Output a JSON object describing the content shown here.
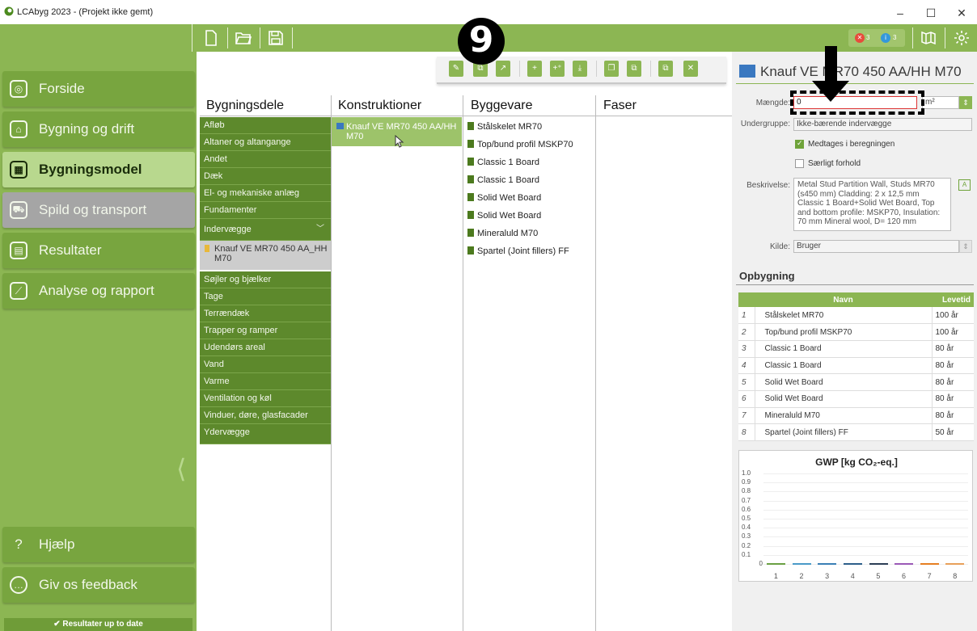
{
  "window": {
    "title": "LCAbyg 2023 - (Projekt ikke gemt)",
    "minimize": "–",
    "maximize": "☐",
    "close": "✕"
  },
  "badges": {
    "errors": "3",
    "infos": "3"
  },
  "step_number": "9",
  "nav": [
    {
      "label": "Forside"
    },
    {
      "label": "Bygning og drift"
    },
    {
      "label": "Bygningsmodel"
    },
    {
      "label": "Spild og transport"
    },
    {
      "label": "Resultater"
    },
    {
      "label": "Analyse og rapport"
    }
  ],
  "nav_bottom": [
    {
      "label": "Hjælp"
    },
    {
      "label": "Giv os feedback"
    }
  ],
  "status": "✔ Resultater up to date",
  "columns": {
    "bygningsdele": "Bygningsdele",
    "konstruktioner": "Konstruktioner",
    "byggevare": "Byggevare",
    "faser": "Faser"
  },
  "categories": [
    "Afløb",
    "Altaner og altangange",
    "Andet",
    "Dæk",
    "El- og mekaniske anlæg",
    "Fundamenter",
    "Indervægge"
  ],
  "selected_category_item": "Knauf VE MR70 450 AA_HH M70",
  "categories_after": [
    "Søjler og bjælker",
    "Tage",
    "Terrændæk",
    "Trapper og ramper",
    "Udendørs areal",
    "Vand",
    "Varme",
    "Ventilation og køl",
    "Vinduer, døre, glasfacader",
    "Ydervægge"
  ],
  "konstruktion": "Knauf VE MR70 450 AA/HH M70",
  "byggevarer": [
    "Stålskelet MR70",
    "Top/bund profil MSKP70",
    "Classic 1 Board",
    "Classic 1 Board",
    "Solid Wet Board",
    "Solid Wet Board",
    "Mineraluld M70",
    "Spartel (Joint fillers) FF"
  ],
  "detail": {
    "title": "Knauf VE MR70 450 AA/HH M70",
    "maengde_label": "Mængde:",
    "maengde_value": "0",
    "unit": "m²",
    "undergruppe_label": "Undergruppe:",
    "undergruppe_value": "Ikke-bærende indervægge",
    "medtages_label": "Medtages i beregningen",
    "saerligt_label": "Særligt forhold",
    "beskrivelse_label": "Beskrivelse:",
    "beskrivelse_value": "Metal Stud Partition Wall, Studs MR70 (s450 mm) Cladding: 2 x 12,5 mm Classic 1 Board+Solid Wet Board, Top and bottom profile: MSKP70, Insulation: 70 mm Mineral wool, D= 120 mm",
    "kilde_label": "Kilde:",
    "kilde_value": "Bruger"
  },
  "opbygning": {
    "title": "Opbygning",
    "headers": {
      "num": "",
      "navn": "Navn",
      "levetid": "Levetid"
    },
    "rows": [
      {
        "n": "1",
        "navn": "Stålskelet MR70",
        "levetid": "100 år"
      },
      {
        "n": "2",
        "navn": "Top/bund profil MSKP70",
        "levetid": "100 år"
      },
      {
        "n": "3",
        "navn": "Classic 1 Board",
        "levetid": "80 år"
      },
      {
        "n": "4",
        "navn": "Classic 1 Board",
        "levetid": "80 år"
      },
      {
        "n": "5",
        "navn": "Solid Wet Board",
        "levetid": "80 år"
      },
      {
        "n": "6",
        "navn": "Solid Wet Board",
        "levetid": "80 år"
      },
      {
        "n": "7",
        "navn": "Mineraluld M70",
        "levetid": "80 år"
      },
      {
        "n": "8",
        "navn": "Spartel (Joint fillers) FF",
        "levetid": "50 år"
      }
    ]
  },
  "chart_data": {
    "type": "bar",
    "title": "GWP [kg CO₂-eq.]",
    "categories": [
      "1",
      "2",
      "3",
      "4",
      "5",
      "6",
      "7",
      "8"
    ],
    "values": [
      0,
      0,
      0,
      0,
      0,
      0,
      0,
      0
    ],
    "yticks": [
      "1.0",
      "0.9",
      "0.8",
      "0.7",
      "0.6",
      "0.5",
      "0.4",
      "0.3",
      "0.2",
      "0.1",
      "0"
    ],
    "ylim": [
      0,
      1.0
    ],
    "colors": [
      "#6aa043",
      "#4a9ac8",
      "#3a7fb5",
      "#2d5f8a",
      "#2b3e55",
      "#9b59b6",
      "#e67e22",
      "#e8a05a"
    ]
  }
}
